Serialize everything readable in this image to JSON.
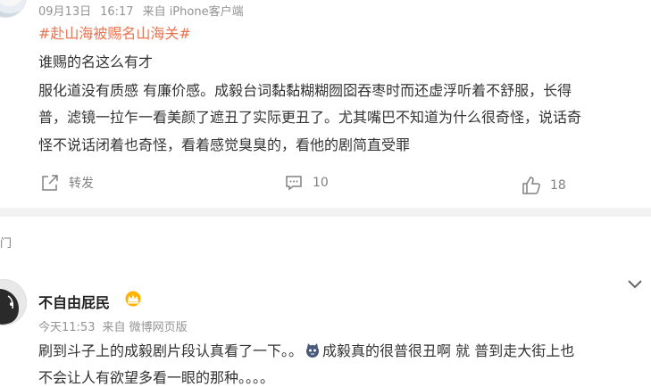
{
  "post1": {
    "date": "09月13日",
    "time": "16:17",
    "source": "来自 iPhone客户端",
    "hashtag": "#赴山海被赐名山海关#",
    "lines": [
      "谁赐的名这么有才",
      "服化道没有质感 有廉价感。成毅台词黏黏糊糊囫囵吞枣时而还虚浮听着不舒服，长得",
      "普，滤镜一拉乍一看美颜了遮丑了实际更丑了。尤其嘴巴不知道为什么很奇怪，说话奇",
      "怪不说话闭着也奇怪，看着感觉臭臭的，看他的剧简直受罪"
    ],
    "repost_label": "转发",
    "comment_count": "10",
    "like_count": "18"
  },
  "section_label": "门",
  "post2": {
    "username": "不自由屁民",
    "time": "今天11:53",
    "source": "来自 微博网页版",
    "line1_a": "刷到斗子上的成毅剧片段认真看了一下。。",
    "line1_b": "成毅真的很普很丑啊 就 普到走大街上也",
    "line2": "不会让人有欲望多看一眼的那种。。。。"
  },
  "icons": {
    "repost": "share-icon",
    "comment": "comment-icon",
    "like": "thumbs-up-icon",
    "vip": "crown-icon",
    "expand": "chevron-down-icon",
    "emoji": "cat-emoji-icon"
  },
  "colors": {
    "hashtag": "#eb7350",
    "meta": "#939393",
    "divider": "#f2f2f2"
  }
}
